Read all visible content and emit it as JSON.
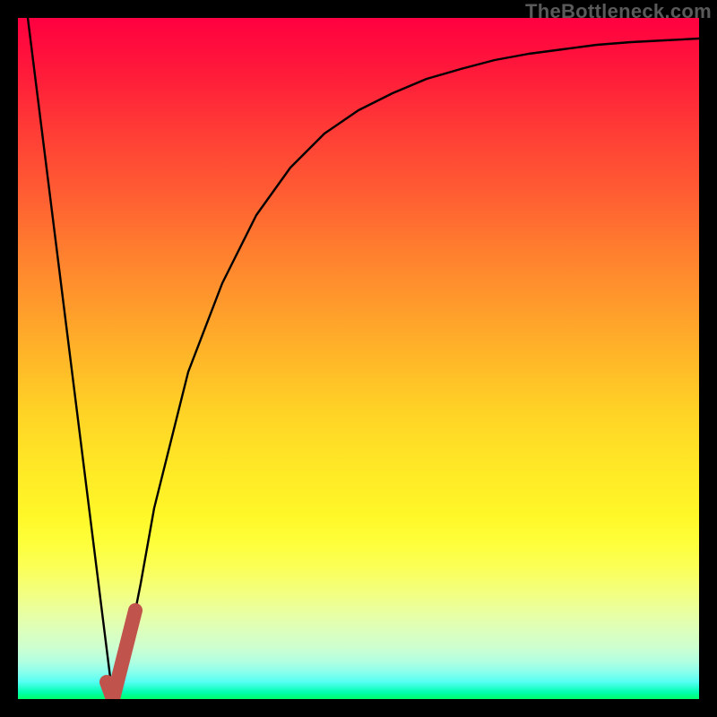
{
  "watermark": {
    "text": "TheBottleneck.com"
  },
  "colors": {
    "background": "#000000",
    "curve": "#000000",
    "highlight": "#c1534d"
  },
  "chart_data": {
    "type": "line",
    "title": "",
    "xlabel": "",
    "ylabel": "",
    "xlim": [
      0,
      100
    ],
    "ylim": [
      0,
      100
    ],
    "grid": false,
    "series": [
      {
        "name": "bottleneck-curve",
        "x": [
          1.5,
          14,
          16,
          18,
          20,
          25,
          30,
          35,
          40,
          45,
          50,
          55,
          60,
          65,
          70,
          75,
          80,
          85,
          90,
          95,
          100
        ],
        "values": [
          100,
          0,
          7,
          17,
          28,
          48,
          61,
          71,
          78,
          83,
          86.5,
          89,
          91,
          92.5,
          93.8,
          94.7,
          95.4,
          96,
          96.4,
          96.7,
          97
        ]
      },
      {
        "name": "highlight-segment",
        "x": [
          13,
          14,
          17.3
        ],
        "values": [
          2.5,
          0,
          13
        ]
      }
    ]
  }
}
